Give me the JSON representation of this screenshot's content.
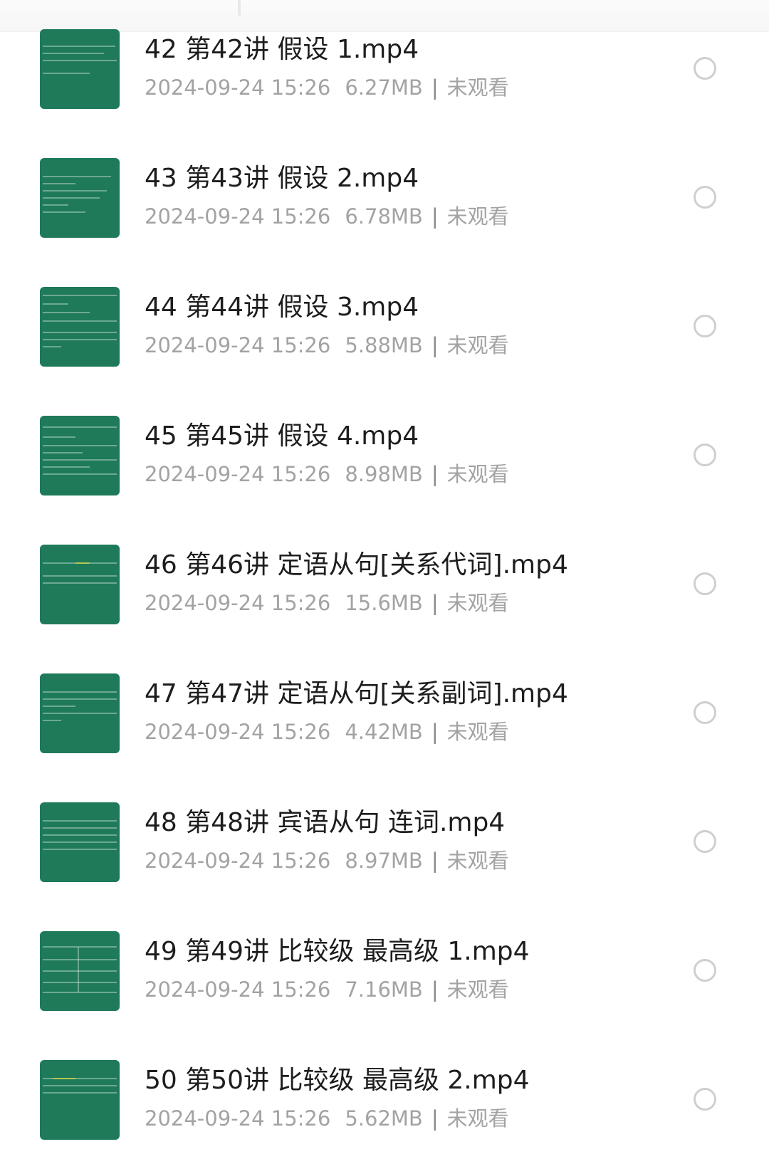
{
  "items": [
    {
      "title": "42 第42讲 假设 1.mp4",
      "date": "2024-09-24 15:26",
      "size": "6.27MB",
      "status": "未观看"
    },
    {
      "title": "43 第43讲 假设 2.mp4",
      "date": "2024-09-24 15:26",
      "size": "6.78MB",
      "status": "未观看"
    },
    {
      "title": "44 第44讲 假设 3.mp4",
      "date": "2024-09-24 15:26",
      "size": "5.88MB",
      "status": "未观看"
    },
    {
      "title": "45 第45讲 假设 4.mp4",
      "date": "2024-09-24 15:26",
      "size": "8.98MB",
      "status": "未观看"
    },
    {
      "title": "46 第46讲 定语从句[关系代词].mp4",
      "date": "2024-09-24 15:26",
      "size": "15.6MB",
      "status": "未观看"
    },
    {
      "title": "47 第47讲 定语从句[关系副词].mp4",
      "date": "2024-09-24 15:26",
      "size": "4.42MB",
      "status": "未观看"
    },
    {
      "title": "48 第48讲 宾语从句 连词.mp4",
      "date": "2024-09-24 15:26",
      "size": "8.97MB",
      "status": "未观看"
    },
    {
      "title": "49 第49讲 比较级 最高级 1.mp4",
      "date": "2024-09-24 15:26",
      "size": "7.16MB",
      "status": "未观看"
    },
    {
      "title": "50 第50讲 比较级 最高级 2.mp4",
      "date": "2024-09-24 15:26",
      "size": "5.62MB",
      "status": "未观看"
    }
  ],
  "colors": {
    "thumbnail_bg": "#1f7a5a",
    "title": "#1d1d1d",
    "meta": "#a3a3a3",
    "radio_border": "#cfcfcf"
  },
  "icons": {
    "thumbnail": "video-thumbnail-icon",
    "select": "radio-circle-icon"
  }
}
